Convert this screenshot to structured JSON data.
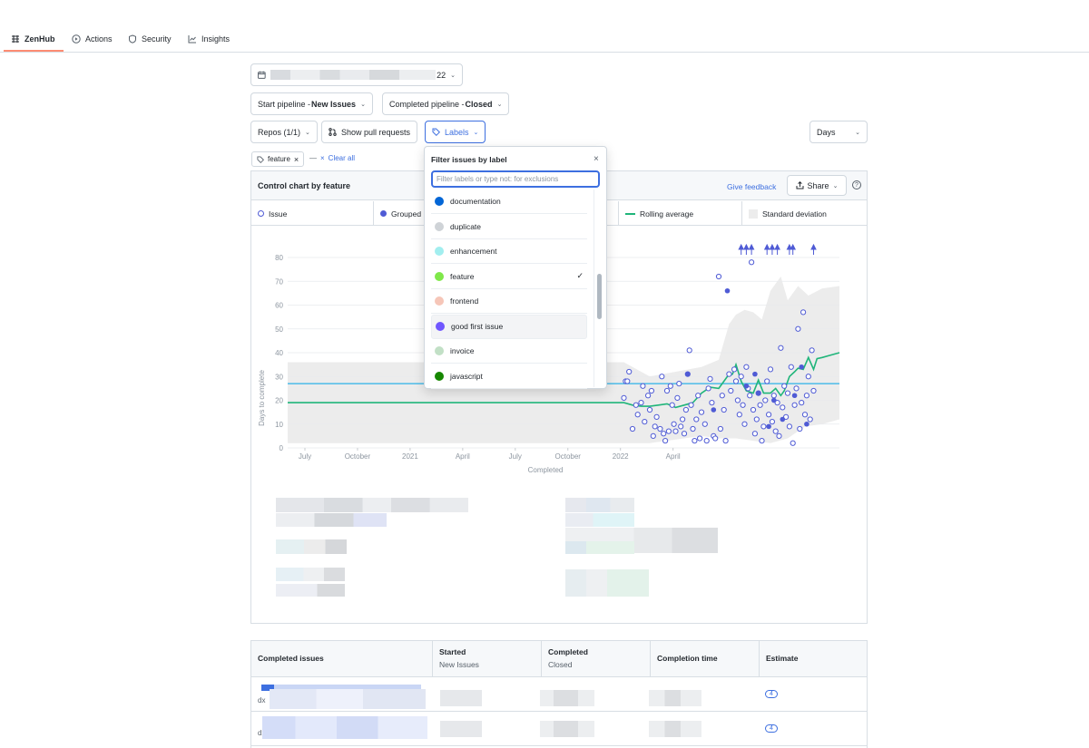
{
  "nav": {
    "items": [
      {
        "label": "ZenHub",
        "icon": "zenhub-icon",
        "active": true
      },
      {
        "label": "Actions",
        "icon": "play-icon"
      },
      {
        "label": "Security",
        "icon": "shield-icon"
      },
      {
        "label": "Insights",
        "icon": "graph-icon"
      }
    ]
  },
  "filters": {
    "date_range_suffix": "22",
    "start_pipeline_label": "Start pipeline - ",
    "start_pipeline_value": "New Issues",
    "completed_pipeline_label": "Completed pipeline - ",
    "completed_pipeline_value": "Closed",
    "repos": "Repos (1/1)",
    "show_pull_requests": "Show pull requests",
    "labels": "Labels",
    "days": "Days",
    "active_chip": "feature",
    "clear_all": "Clear all"
  },
  "panel": {
    "title": "Control chart by feature",
    "give_feedback": "Give feedback",
    "share": "Share",
    "legend": [
      "Issue",
      "Grouped",
      "Rolling average",
      "Standard deviation"
    ]
  },
  "dropdown": {
    "title": "Filter issues by label",
    "placeholder": "Filter labels or type not: for exclusions",
    "items": [
      {
        "name": "documentation",
        "color": "#0366d6"
      },
      {
        "name": "duplicate",
        "color": "#cfd3d7"
      },
      {
        "name": "enhancement",
        "color": "#a2eeef"
      },
      {
        "name": "feature",
        "color": "#7fe84a",
        "checked": true
      },
      {
        "name": "frontend",
        "color": "#f6c6b8"
      },
      {
        "name": "good first issue",
        "color": "#7057ff"
      },
      {
        "name": "invoice",
        "color": "#c2e0c6"
      },
      {
        "name": "javascript",
        "color": "#168700"
      }
    ]
  },
  "chart_data": {
    "type": "scatter",
    "xlabel": "Completed",
    "ylabel": "Days to complete",
    "ylim": [
      0,
      80
    ],
    "yticks": [
      0,
      10,
      20,
      30,
      40,
      50,
      60,
      70,
      80
    ],
    "xticks": [
      "July",
      "October",
      "2021",
      "April",
      "July",
      "October",
      "2022",
      "April"
    ],
    "grid": true,
    "mean_line": 27,
    "colors": {
      "issue": "#4f5bd5",
      "rolling": "#1fb57a",
      "mean": "#2cb2e8",
      "std": "#ececec"
    },
    "series": [
      {
        "name": "Issue",
        "points": [
          [
            19.5,
            21
          ],
          [
            19.6,
            28
          ],
          [
            19.7,
            28
          ],
          [
            19.8,
            32
          ],
          [
            20,
            8
          ],
          [
            20.2,
            18
          ],
          [
            20.3,
            14
          ],
          [
            20.5,
            19
          ],
          [
            20.6,
            26
          ],
          [
            20.7,
            11
          ],
          [
            20.9,
            22
          ],
          [
            21,
            16
          ],
          [
            21.1,
            24
          ],
          [
            21.2,
            5
          ],
          [
            21.3,
            9
          ],
          [
            21.4,
            13
          ],
          [
            21.6,
            8
          ],
          [
            21.7,
            30
          ],
          [
            21.8,
            6
          ],
          [
            21.9,
            3
          ],
          [
            22,
            24
          ],
          [
            22.1,
            7
          ],
          [
            22.2,
            26
          ],
          [
            22.3,
            18
          ],
          [
            22.4,
            10
          ],
          [
            22.5,
            7
          ],
          [
            22.6,
            21
          ],
          [
            22.7,
            27
          ],
          [
            22.8,
            9
          ],
          [
            22.9,
            12
          ],
          [
            23,
            6
          ],
          [
            23.1,
            16
          ],
          [
            23.2,
            31
          ],
          [
            23.3,
            41
          ],
          [
            23.4,
            18
          ],
          [
            23.5,
            8
          ],
          [
            23.6,
            3
          ],
          [
            23.7,
            12
          ],
          [
            23.8,
            22
          ],
          [
            23.9,
            4
          ],
          [
            24,
            15
          ],
          [
            24.2,
            10
          ],
          [
            24.3,
            3
          ],
          [
            24.4,
            25
          ],
          [
            24.5,
            29
          ],
          [
            24.6,
            19
          ],
          [
            24.7,
            5
          ],
          [
            24.8,
            4
          ],
          [
            25,
            72
          ],
          [
            25.1,
            8
          ],
          [
            25.2,
            22
          ],
          [
            25.3,
            16
          ],
          [
            25.4,
            3
          ],
          [
            25.6,
            31
          ],
          [
            25.7,
            24
          ],
          [
            25.9,
            33
          ],
          [
            26,
            28
          ],
          [
            26.1,
            20
          ],
          [
            26.2,
            14
          ],
          [
            26.3,
            30
          ],
          [
            26.4,
            18
          ],
          [
            26.5,
            10
          ],
          [
            26.6,
            34
          ],
          [
            26.7,
            25
          ],
          [
            26.8,
            22
          ],
          [
            26.9,
            78
          ],
          [
            27,
            16
          ],
          [
            27.1,
            6
          ],
          [
            27.2,
            12
          ],
          [
            27.3,
            23
          ],
          [
            27.4,
            18
          ],
          [
            27.5,
            3
          ],
          [
            27.6,
            9
          ],
          [
            27.7,
            20
          ],
          [
            27.8,
            28
          ],
          [
            27.9,
            14
          ],
          [
            28,
            33
          ],
          [
            28.1,
            11
          ],
          [
            28.2,
            22
          ],
          [
            28.3,
            7
          ],
          [
            28.4,
            19
          ],
          [
            28.5,
            5
          ],
          [
            28.6,
            42
          ],
          [
            28.7,
            17
          ],
          [
            28.8,
            26
          ],
          [
            28.9,
            13
          ],
          [
            29,
            23
          ],
          [
            29.1,
            9
          ],
          [
            29.2,
            34
          ],
          [
            29.3,
            2
          ],
          [
            29.4,
            18
          ],
          [
            29.5,
            25
          ],
          [
            29.6,
            50
          ],
          [
            29.7,
            8
          ],
          [
            29.8,
            19
          ],
          [
            29.9,
            57
          ],
          [
            30,
            14
          ],
          [
            30.1,
            22
          ],
          [
            30.2,
            30
          ],
          [
            30.3,
            12
          ],
          [
            30.4,
            41
          ],
          [
            30.5,
            24
          ]
        ]
      },
      {
        "name": "Grouped",
        "points": [
          [
            23.2,
            31
          ],
          [
            24.7,
            16
          ],
          [
            25.5,
            66
          ],
          [
            26.6,
            26
          ],
          [
            27.1,
            31
          ],
          [
            27.3,
            23
          ],
          [
            27.9,
            9
          ],
          [
            28.2,
            20
          ],
          [
            28.7,
            12
          ],
          [
            29.4,
            22
          ],
          [
            29.8,
            34
          ],
          [
            30.1,
            10
          ]
        ]
      },
      {
        "name": "Rolling average",
        "points": [
          [
            0,
            19
          ],
          [
            19.5,
            19
          ],
          [
            20,
            18
          ],
          [
            20.5,
            17.5
          ],
          [
            21,
            17.5
          ],
          [
            21.5,
            18
          ],
          [
            22,
            18.5
          ],
          [
            22.5,
            17
          ],
          [
            23,
            18
          ],
          [
            23.5,
            19
          ],
          [
            24,
            23
          ],
          [
            24.5,
            25.5
          ],
          [
            25,
            25
          ],
          [
            25.5,
            30
          ],
          [
            25.8,
            31
          ],
          [
            26,
            35
          ],
          [
            26.3,
            28
          ],
          [
            26.6,
            24
          ],
          [
            27,
            23
          ],
          [
            27.3,
            28.5
          ],
          [
            27.6,
            23
          ],
          [
            28,
            23
          ],
          [
            28.3,
            25
          ],
          [
            28.6,
            22
          ],
          [
            28.8,
            24
          ],
          [
            29.1,
            30
          ],
          [
            29.4,
            32
          ],
          [
            29.6,
            33.5
          ],
          [
            29.9,
            33
          ],
          [
            30.2,
            38
          ],
          [
            30.5,
            33
          ],
          [
            30.7,
            37.5
          ],
          [
            31,
            38
          ],
          [
            31.5,
            39
          ],
          [
            32,
            40
          ]
        ]
      }
    ],
    "outliers_top": 9
  },
  "table": {
    "headers": [
      {
        "main": "Completed issues"
      },
      {
        "main": "Started",
        "sub": "New Issues"
      },
      {
        "main": "Completed",
        "sub": "Closed"
      },
      {
        "main": "Completion time"
      },
      {
        "main": "Estimate"
      }
    ],
    "rows": [
      {
        "prefix": "dx",
        "estimate": "4"
      },
      {
        "prefix": "dx",
        "estimate": "4"
      }
    ]
  }
}
